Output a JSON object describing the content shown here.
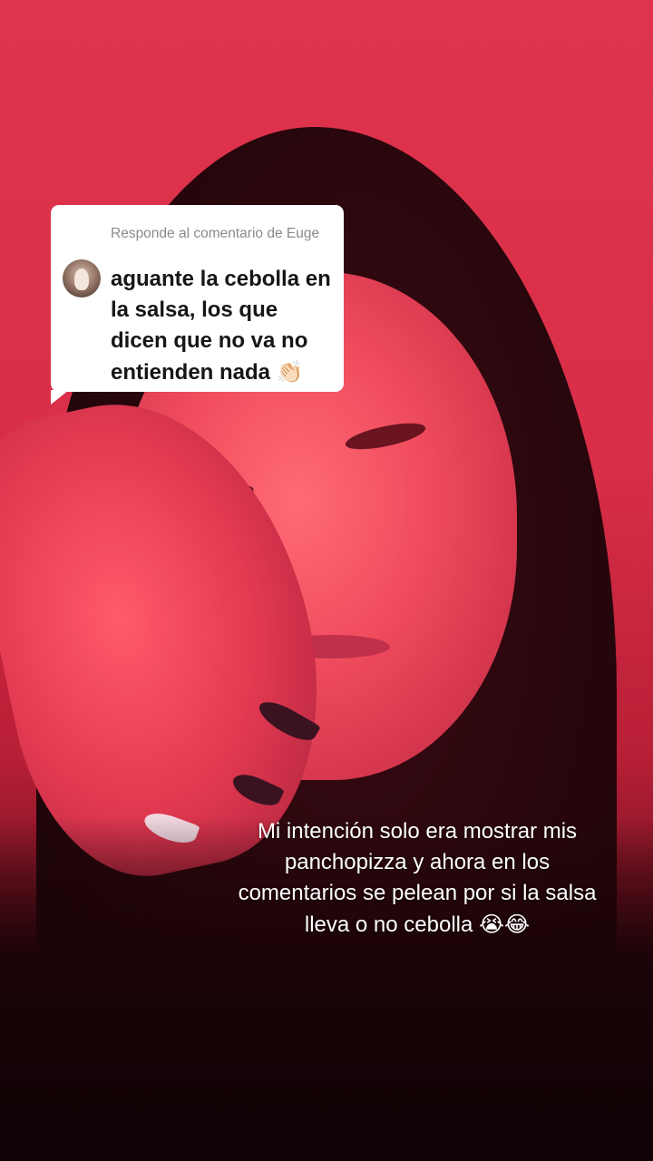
{
  "reply_card": {
    "header": "Responde al comentario de Euge",
    "comment": "aguante la cebolla en la salsa, los que dicen que no va no entienden nada",
    "comment_emoji": "👏🏻",
    "avatar_icon": "user-avatar-photo"
  },
  "caption": {
    "text": "Mi intención solo era mostrar mis panchopizza y ahora en los comentarios se pelean por si la salsa lleva o no cebolla",
    "emoji": "😭😂"
  },
  "colors": {
    "background_red": "#e0344e",
    "card_bg": "#ffffff",
    "caption_text": "#ffffff"
  }
}
